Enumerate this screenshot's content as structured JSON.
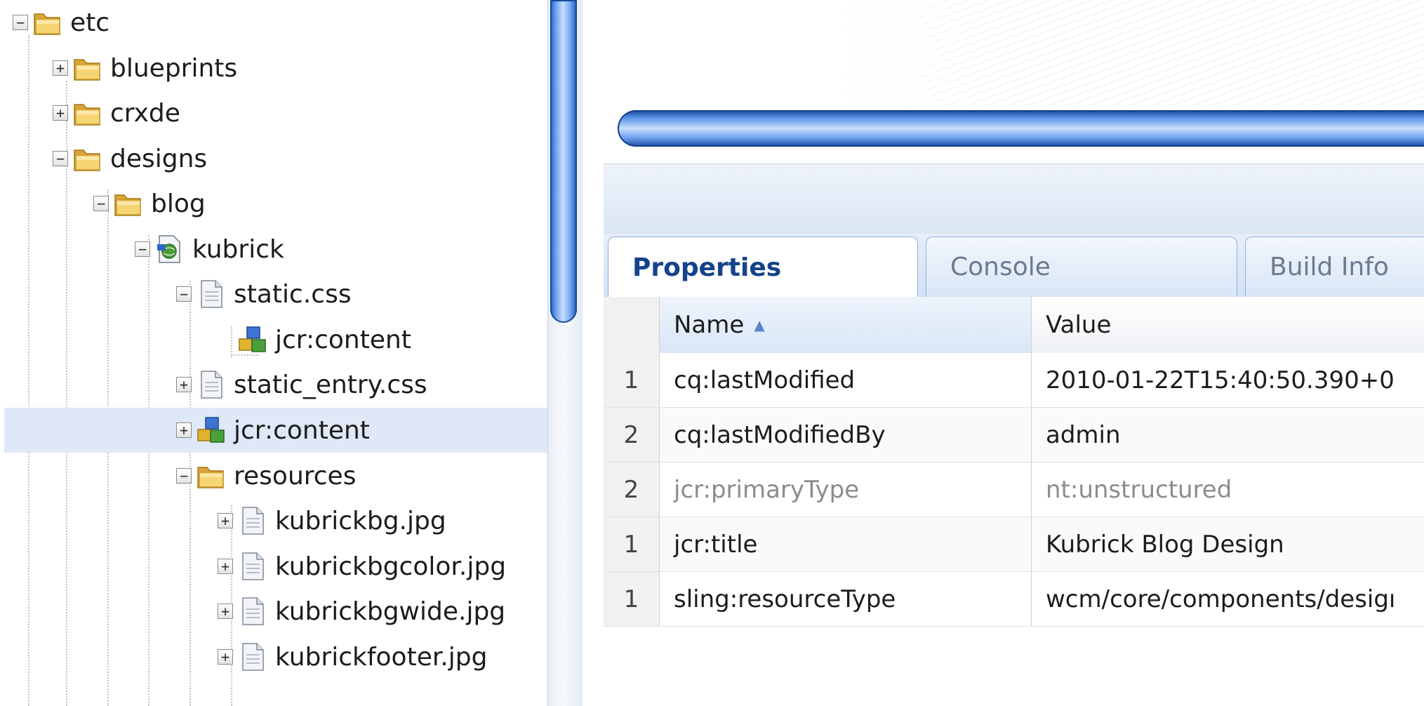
{
  "tree": {
    "nodes": [
      {
        "label": "etc",
        "toggle": "−",
        "icon": "folder-icon"
      },
      {
        "label": "blueprints",
        "toggle": "+",
        "icon": "folder-icon"
      },
      {
        "label": "crxde",
        "toggle": "+",
        "icon": "folder-icon"
      },
      {
        "label": "designs",
        "toggle": "−",
        "icon": "folder-icon"
      },
      {
        "label": "blog",
        "toggle": "−",
        "icon": "folder-icon"
      },
      {
        "label": "kubrick",
        "toggle": "−",
        "icon": "page-icon"
      },
      {
        "label": "static.css",
        "toggle": "−",
        "icon": "file-icon"
      },
      {
        "label": "jcr:content",
        "toggle": "",
        "icon": "node-icon"
      },
      {
        "label": "static_entry.css",
        "toggle": "+",
        "icon": "file-icon"
      },
      {
        "label": "jcr:content",
        "toggle": "+",
        "icon": "node-icon",
        "selected": true
      },
      {
        "label": "resources",
        "toggle": "−",
        "icon": "folder-icon"
      },
      {
        "label": "kubrickbg.jpg",
        "toggle": "+",
        "icon": "file-icon"
      },
      {
        "label": "kubrickbgcolor.jpg",
        "toggle": "+",
        "icon": "file-icon"
      },
      {
        "label": "kubrickbgwide.jpg",
        "toggle": "+",
        "icon": "file-icon"
      },
      {
        "label": "kubrickfooter.jpg",
        "toggle": "+",
        "icon": "file-icon"
      }
    ]
  },
  "tabs": [
    {
      "label": "Properties",
      "active": true
    },
    {
      "label": "Console",
      "active": false
    },
    {
      "label": "Build Info",
      "active": false
    }
  ],
  "grid": {
    "headers": {
      "name": "Name",
      "value": "Value"
    },
    "sort_indicator": "▲",
    "rows": [
      {
        "num": "1",
        "name": "cq:lastModified",
        "value": "2010-01-22T15:40:50.390+0"
      },
      {
        "num": "2",
        "name": "cq:lastModifiedBy",
        "value": "admin"
      },
      {
        "num": "2",
        "name": "jcr:primaryType",
        "value": "nt:unstructured",
        "muted": true
      },
      {
        "num": "1",
        "name": "jcr:title",
        "value": "Kubrick Blog Design"
      },
      {
        "num": "1",
        "name": "sling:resourceType",
        "value": "wcm/core/components/desigı"
      }
    ]
  },
  "colors": {
    "selected_row": "#dfe8f6",
    "active_tab_text": "#15428b",
    "scrollbar_blue": "#3a7ad9"
  }
}
